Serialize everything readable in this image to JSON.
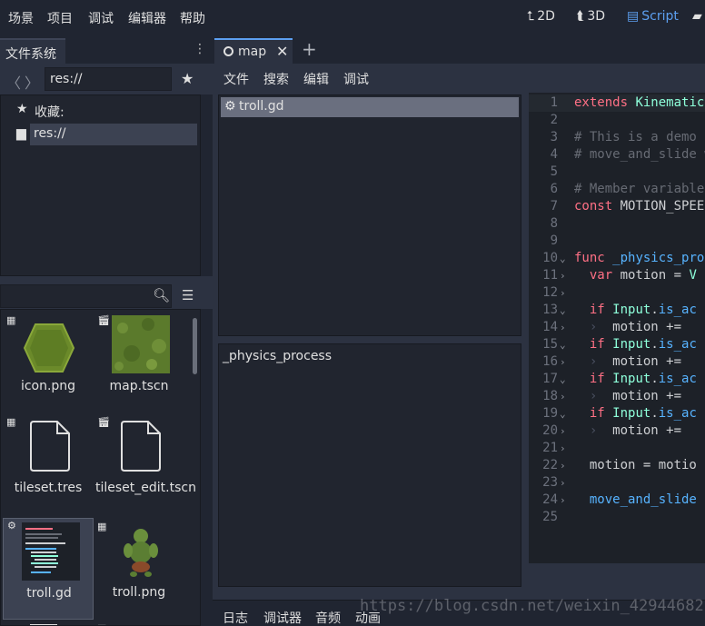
{
  "menubar": {
    "items": [
      "场景",
      "项目",
      "调试",
      "编辑器",
      "帮助"
    ],
    "modes": [
      {
        "icon": "2d-icon",
        "label": "2D"
      },
      {
        "icon": "3d-icon",
        "label": "3D"
      },
      {
        "icon": "script-icon",
        "label": "Script"
      }
    ],
    "store_icon": "assetlib-icon"
  },
  "filesystem": {
    "tab_label": "文件系统",
    "path": "res://",
    "favorites_label": "收藏:",
    "root_label": "res://",
    "files": [
      {
        "name": "icon.png",
        "badge": "image-icon"
      },
      {
        "name": "map.tscn",
        "badge": "scene-icon"
      },
      {
        "name": "tileset.tres",
        "badge": "tileset-icon"
      },
      {
        "name": "tileset_edit.tscn",
        "badge": "scene-icon"
      },
      {
        "name": "troll.gd",
        "badge": "gear-icon"
      },
      {
        "name": "troll.png",
        "badge": "image-icon"
      }
    ]
  },
  "editor": {
    "tab_label": "map",
    "script_menu": [
      "文件",
      "搜索",
      "编辑",
      "调试"
    ],
    "scripts": [
      "troll.gd"
    ],
    "methods": [
      "_physics_process"
    ]
  },
  "code_lines": [
    {
      "n": "1",
      "fold": "",
      "segs": [
        [
          "kw",
          "extends "
        ],
        [
          "ty",
          "KinematicB"
        ]
      ]
    },
    {
      "n": "2",
      "fold": "",
      "segs": []
    },
    {
      "n": "3",
      "fold": "",
      "segs": [
        [
          "cm",
          "# This is a demo s"
        ]
      ]
    },
    {
      "n": "4",
      "fold": "",
      "segs": [
        [
          "cm",
          "# move_and_slide w"
        ]
      ]
    },
    {
      "n": "5",
      "fold": "",
      "segs": []
    },
    {
      "n": "6",
      "fold": "",
      "segs": [
        [
          "cm",
          "# Member variables"
        ]
      ]
    },
    {
      "n": "7",
      "fold": "",
      "segs": [
        [
          "kw",
          "const "
        ],
        [
          "tx",
          "MOTION_SPEED"
        ]
      ]
    },
    {
      "n": "8",
      "fold": "",
      "segs": []
    },
    {
      "n": "9",
      "fold": "",
      "segs": []
    },
    {
      "n": "10",
      "fold": "v",
      "segs": [
        [
          "kw",
          "func "
        ],
        [
          "fn",
          "_physics_proc"
        ]
      ]
    },
    {
      "n": "11",
      "fold": ">",
      "segs": [
        [
          "tx",
          "  "
        ],
        [
          "kw",
          "var "
        ],
        [
          "tx",
          "motion = "
        ],
        [
          "ty",
          "V"
        ]
      ]
    },
    {
      "n": "12",
      "fold": ">",
      "segs": []
    },
    {
      "n": "13",
      "fold": "v",
      "segs": [
        [
          "tx",
          "  "
        ],
        [
          "kw",
          "if "
        ],
        [
          "ty",
          "Input"
        ],
        [
          "tx",
          "."
        ],
        [
          "fn",
          "is_ac"
        ]
      ]
    },
    {
      "n": "14",
      "fold": ">",
      "segs": [
        [
          "tx",
          "  "
        ],
        [
          "tab",
          "›"
        ],
        [
          "tx",
          "  motion +="
        ]
      ]
    },
    {
      "n": "15",
      "fold": "v",
      "segs": [
        [
          "tx",
          "  "
        ],
        [
          "kw",
          "if "
        ],
        [
          "ty",
          "Input"
        ],
        [
          "tx",
          "."
        ],
        [
          "fn",
          "is_ac"
        ]
      ]
    },
    {
      "n": "16",
      "fold": ">",
      "segs": [
        [
          "tx",
          "  "
        ],
        [
          "tab",
          "›"
        ],
        [
          "tx",
          "  motion +="
        ]
      ]
    },
    {
      "n": "17",
      "fold": "v",
      "segs": [
        [
          "tx",
          "  "
        ],
        [
          "kw",
          "if "
        ],
        [
          "ty",
          "Input"
        ],
        [
          "tx",
          "."
        ],
        [
          "fn",
          "is_ac"
        ]
      ]
    },
    {
      "n": "18",
      "fold": ">",
      "segs": [
        [
          "tx",
          "  "
        ],
        [
          "tab",
          "›"
        ],
        [
          "tx",
          "  motion +="
        ]
      ]
    },
    {
      "n": "19",
      "fold": "v",
      "segs": [
        [
          "tx",
          "  "
        ],
        [
          "kw",
          "if "
        ],
        [
          "ty",
          "Input"
        ],
        [
          "tx",
          "."
        ],
        [
          "fn",
          "is_ac"
        ]
      ]
    },
    {
      "n": "20",
      "fold": ">",
      "segs": [
        [
          "tx",
          "  "
        ],
        [
          "tab",
          "›"
        ],
        [
          "tx",
          "  motion +="
        ]
      ]
    },
    {
      "n": "21",
      "fold": ">",
      "segs": []
    },
    {
      "n": "22",
      "fold": ">",
      "segs": [
        [
          "tx",
          "  motion = motio"
        ]
      ]
    },
    {
      "n": "23",
      "fold": ">",
      "segs": []
    },
    {
      "n": "24",
      "fold": ">",
      "segs": [
        [
          "tx",
          "  "
        ],
        [
          "fn",
          "move_and_slide"
        ]
      ]
    },
    {
      "n": "25",
      "fold": "",
      "segs": []
    }
  ],
  "bottom_tabs": [
    "日志",
    "调试器",
    "音频",
    "动画"
  ],
  "watermark": "https://blog.csdn.net/weixin_42944682",
  "colors": {
    "accent": "#5c9ff0",
    "keyword": "#ff7085",
    "function": "#57b3ff",
    "type": "#8effda",
    "comment": "#676b74"
  }
}
